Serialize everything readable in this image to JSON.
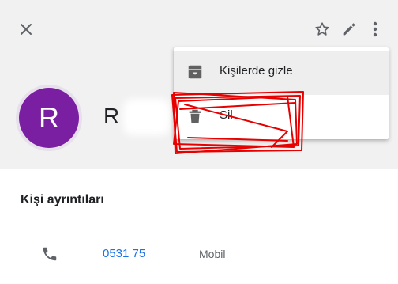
{
  "toolbar": {
    "close_icon": "close-icon",
    "star_icon": "star-outline-icon",
    "edit_icon": "pencil-icon",
    "more_icon": "more-vert-icon"
  },
  "contact": {
    "avatar_letter": "R",
    "avatar_color": "#7b1fa2",
    "name_visible": "R"
  },
  "menu": {
    "items": [
      {
        "label": "Kişilerde gizle",
        "icon": "archive-icon"
      },
      {
        "label": "Sil",
        "icon": "trash-icon"
      }
    ]
  },
  "details": {
    "title": "Kişi ayrıntıları",
    "phone": {
      "number_visible": "0531 75",
      "type": "Mobil",
      "icon": "phone-icon"
    }
  },
  "colors": {
    "accent": "#1a73e8",
    "annotation": "#e60000"
  }
}
